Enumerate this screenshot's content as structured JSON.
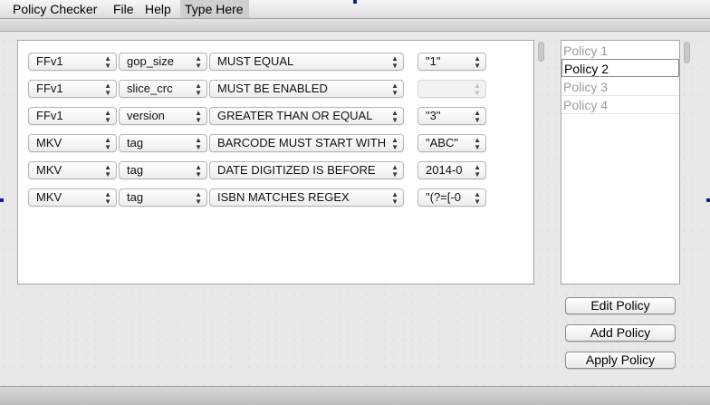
{
  "menubar": {
    "app_name": "Policy Checker",
    "items": [
      "File",
      "Help",
      "Type Here"
    ]
  },
  "rules": [
    {
      "container": "FFv1",
      "field": "gop_size",
      "operator": "MUST EQUAL",
      "value": "\"1\"",
      "value_disabled": false
    },
    {
      "container": "FFv1",
      "field": "slice_crc",
      "operator": "MUST BE ENABLED",
      "value": "",
      "value_disabled": true
    },
    {
      "container": "FFv1",
      "field": "version",
      "operator": "GREATER THAN OR EQUAL",
      "value": "\"3\"",
      "value_disabled": false
    },
    {
      "container": "MKV",
      "field": "tag",
      "operator": "BARCODE MUST START WITH",
      "value": "\"ABC\"",
      "value_disabled": false
    },
    {
      "container": "MKV",
      "field": "tag",
      "operator": "DATE DIGITIZED IS BEFORE",
      "value": "2014-0",
      "value_disabled": false
    },
    {
      "container": "MKV",
      "field": "tag",
      "operator": "ISBN MATCHES REGEX",
      "value": "\"(?=[-0",
      "value_disabled": false
    }
  ],
  "policies": {
    "items": [
      "Policy 1",
      "Policy 2",
      "Policy 3",
      "Policy 4"
    ],
    "selected_index": 1
  },
  "buttons": {
    "edit": "Edit Policy",
    "add": "Add Policy",
    "apply": "Apply Policy"
  },
  "icons": {
    "combo_arrows": "updown-chevron-icon"
  },
  "colors": {
    "window_bg": "#e8e8e8",
    "panel_bg": "#ffffff",
    "disabled_text": "#9a9a9a",
    "selection_marker": "#1a1aa8"
  }
}
